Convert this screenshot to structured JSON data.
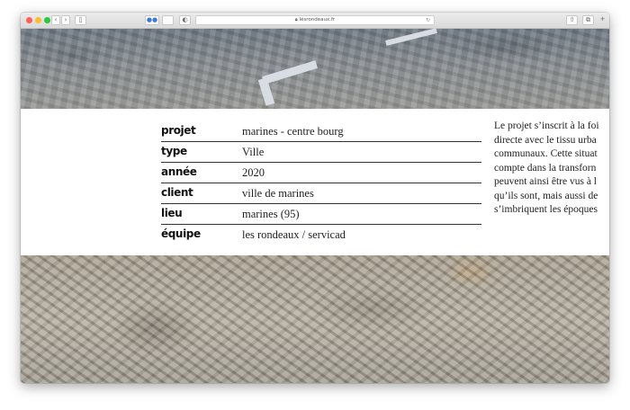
{
  "browser": {
    "url": "lesrondeaux.fr",
    "traffic_colors": {
      "close": "#ff5f57",
      "minimize": "#febc2e",
      "zoom": "#28c840"
    }
  },
  "details": [
    {
      "label": "projet",
      "value": "marines - centre bourg"
    },
    {
      "label": "type",
      "value": "Ville"
    },
    {
      "label": "année",
      "value": "2020"
    },
    {
      "label": "client",
      "value": "ville de marines"
    },
    {
      "label": "lieu",
      "value": "marines (95)"
    },
    {
      "label": "équipe",
      "value": "les rondeaux / servicad"
    }
  ],
  "description_lines": [
    "Le projet s’inscrit à la foi",
    "directe avec le tissu urba",
    "communaux. Cette situat",
    "compte dans la transforn",
    "peuvent ainsi être vus à l",
    "qu’ils sont, mais aussi de",
    "s’imbriquent les époques"
  ]
}
